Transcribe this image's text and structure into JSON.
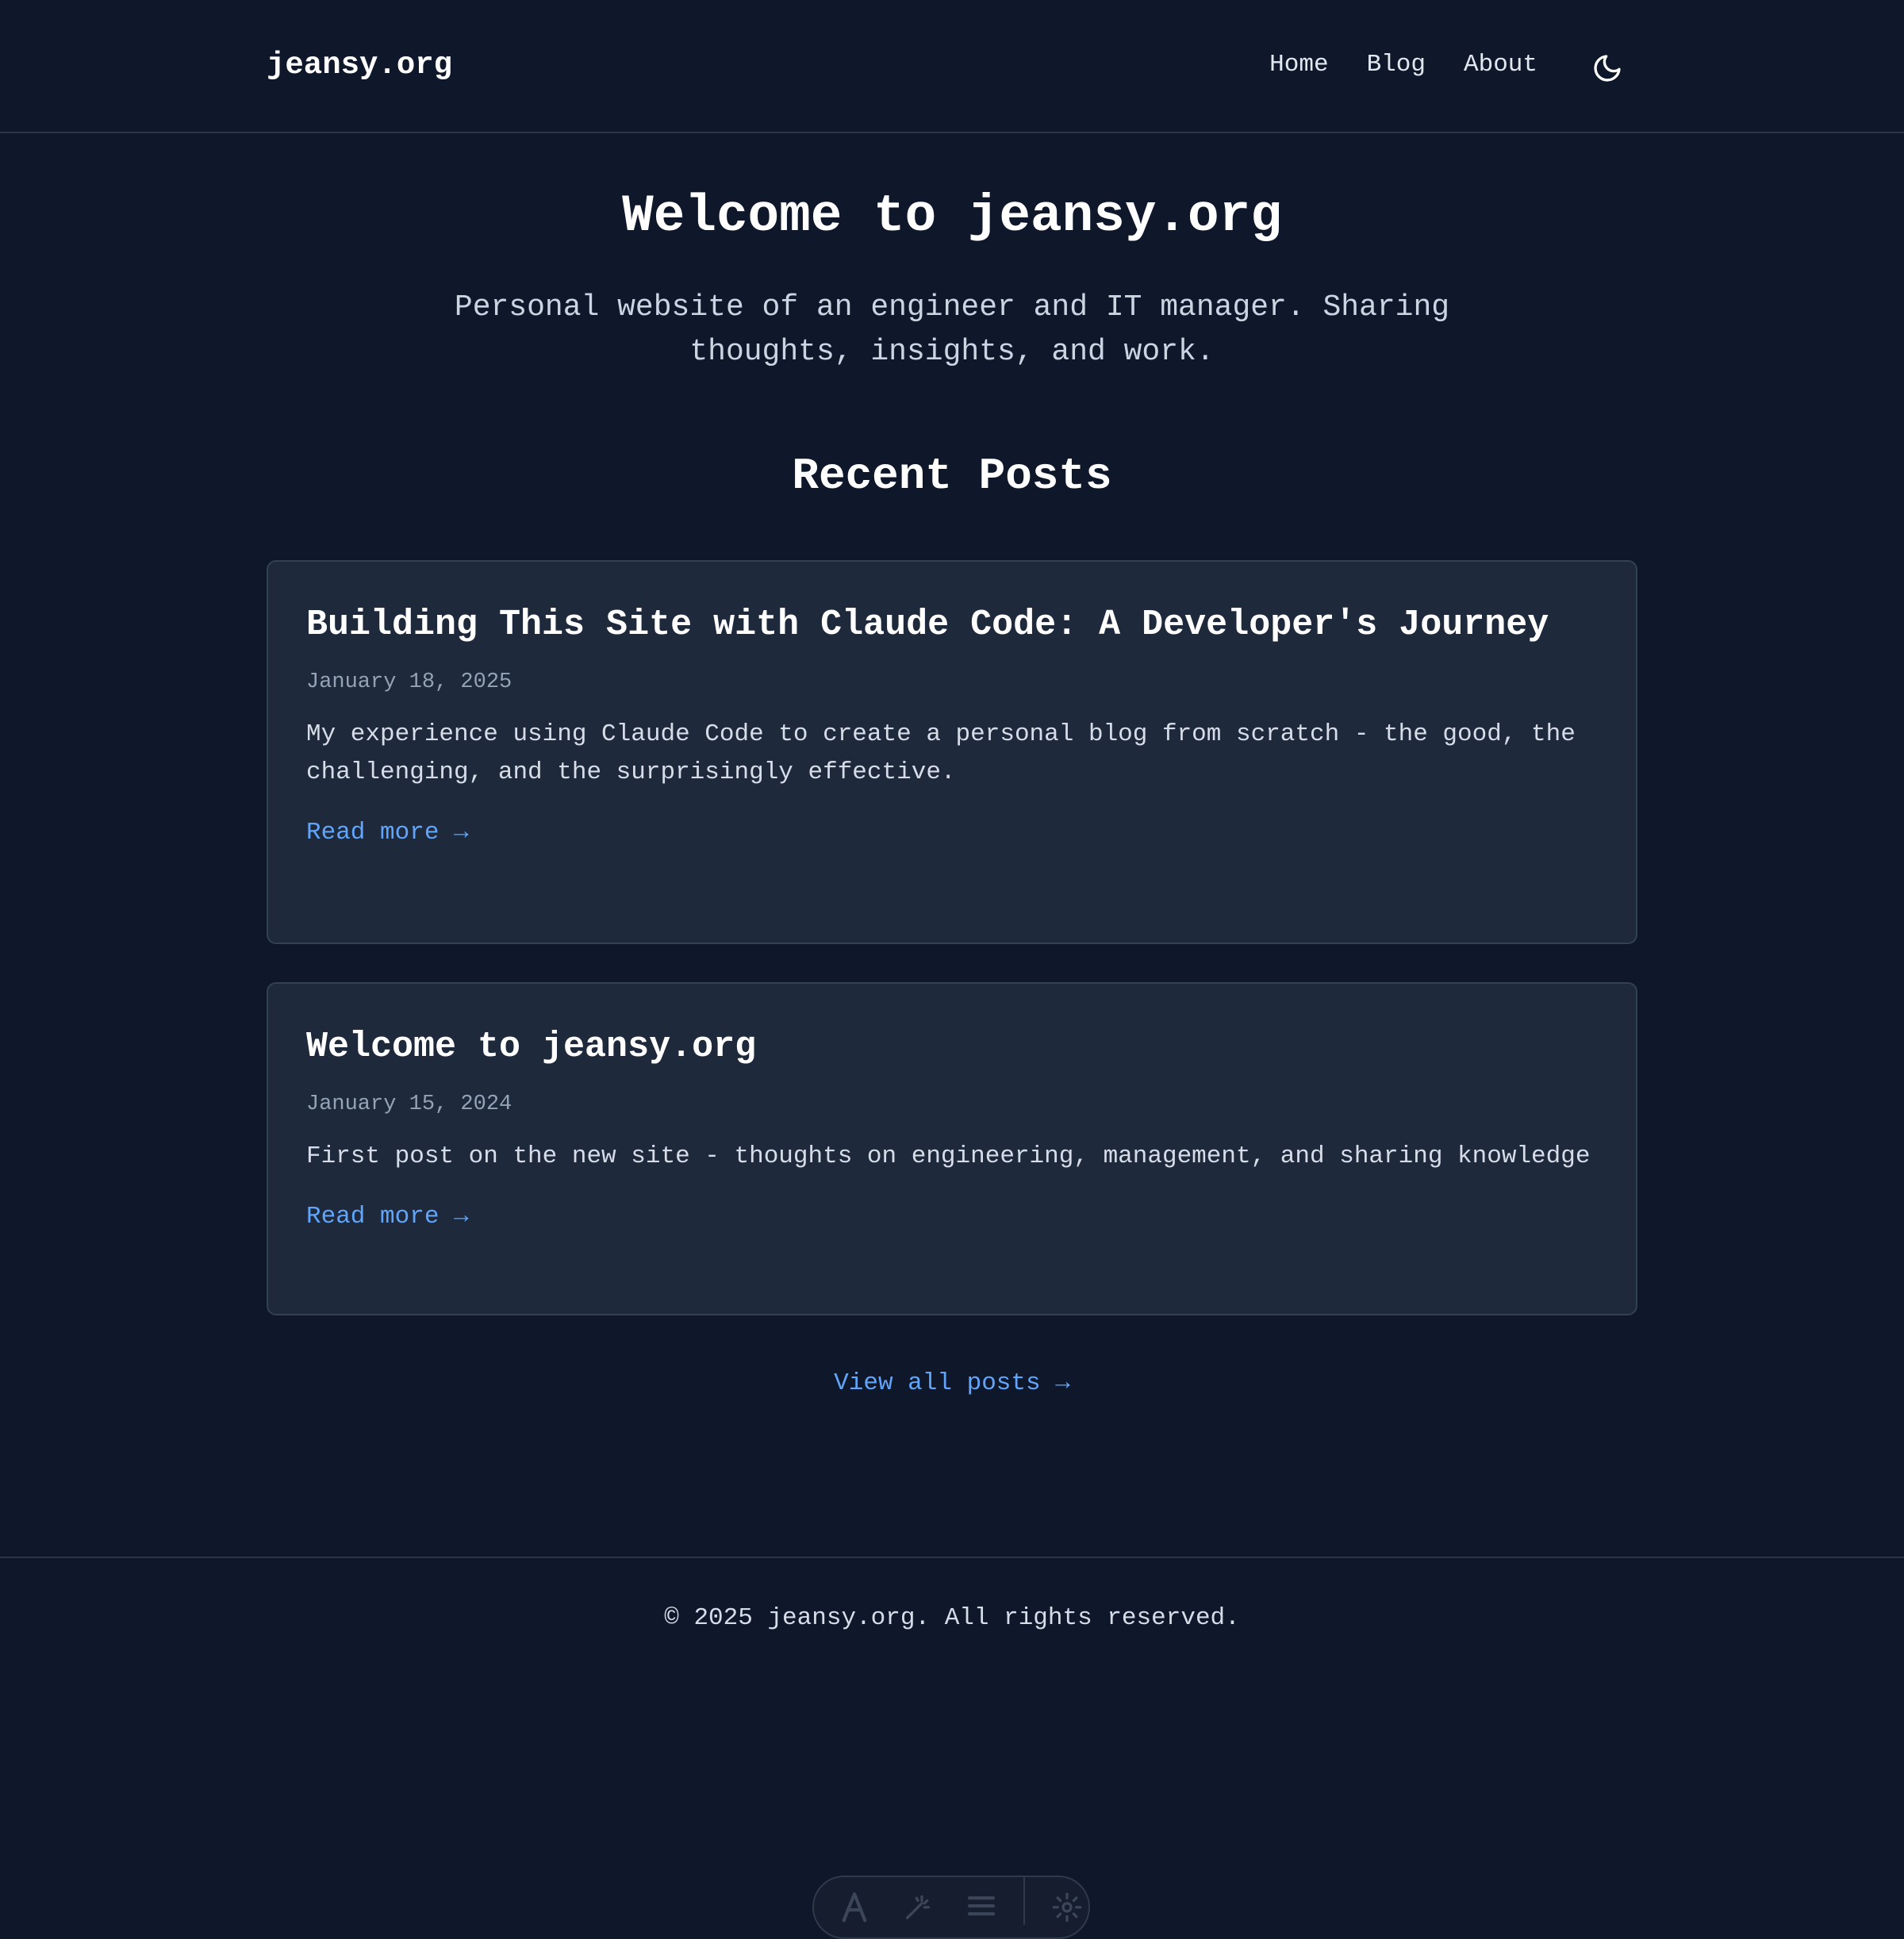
{
  "header": {
    "site_name": "jeansy.org",
    "nav": [
      {
        "label": "Home"
      },
      {
        "label": "Blog"
      },
      {
        "label": "About"
      }
    ],
    "theme_toggle_icon": "moon-icon"
  },
  "hero": {
    "title": "Welcome to jeansy.org",
    "subtitle": "Personal website of an engineer and IT manager. Sharing thoughts, insights, and work."
  },
  "recent_posts": {
    "title": "Recent Posts",
    "posts": [
      {
        "title": "Building This Site with Claude Code: A Developer's Journey",
        "date": "January 18, 2025",
        "excerpt": "My experience using Claude Code to create a personal blog from scratch - the good, the challenging, and the surprisingly effective.",
        "read_more": "Read more →"
      },
      {
        "title": "Welcome to jeansy.org",
        "date": "January 15, 2024",
        "excerpt": "First post on the new site - thoughts on engineering, management, and sharing knowledge",
        "read_more": "Read more →"
      }
    ],
    "view_all": "View all posts →"
  },
  "footer": {
    "copyright": "© 2025 jeansy.org. All rights reserved."
  },
  "toolbar": {
    "icons": [
      "text-icon",
      "magic-icon",
      "align-icon",
      "settings-icon"
    ]
  },
  "colors": {
    "background": "#0f172a",
    "card": "#1e293b",
    "border": "#334155",
    "accent_link": "#60a5fa",
    "muted_text": "#94a3b8"
  }
}
